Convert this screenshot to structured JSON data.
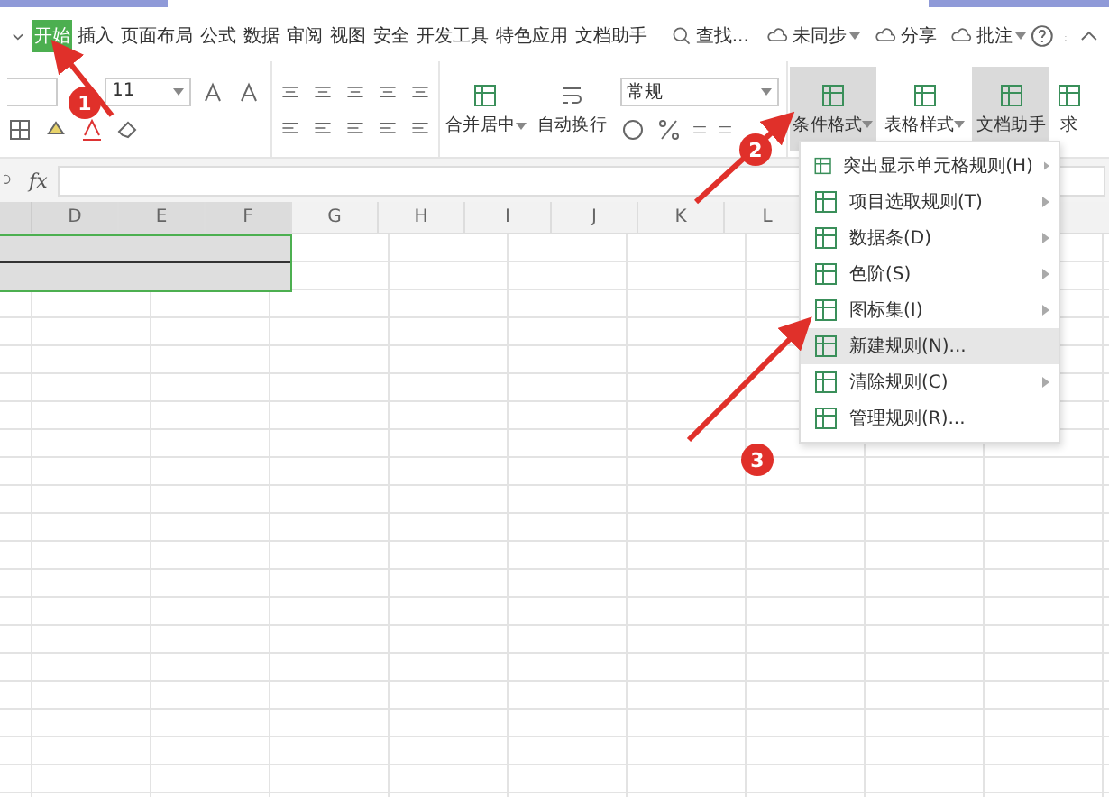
{
  "menu_bar": {
    "tabs": [
      {
        "label": "开始",
        "selected": true
      },
      {
        "label": "插入",
        "selected": false
      },
      {
        "label": "页面布局",
        "selected": false
      },
      {
        "label": "公式",
        "selected": false
      },
      {
        "label": "数据",
        "selected": false
      },
      {
        "label": "审阅",
        "selected": false
      },
      {
        "label": "视图",
        "selected": false
      },
      {
        "label": "安全",
        "selected": false
      },
      {
        "label": "开发工具",
        "selected": false
      },
      {
        "label": "特色应用",
        "selected": false
      },
      {
        "label": "文档助手",
        "selected": false
      }
    ],
    "search": {
      "placeholder": "查找..."
    },
    "actions": [
      {
        "label": "未同步",
        "dropdown": true
      },
      {
        "label": "分享",
        "dropdown": false
      },
      {
        "label": "批注",
        "dropdown": true
      }
    ]
  },
  "ribbon": {
    "font_size": "11",
    "merge_button": "合并居中",
    "wrap_button": "自动换行",
    "number_format": "常规",
    "big_buttons": [
      {
        "label": "条件格式",
        "pressed": true,
        "dropdown": true
      },
      {
        "label": "表格样式",
        "pressed": false,
        "dropdown": true
      },
      {
        "label": "文档助手",
        "pressed": true,
        "dropdown": false
      },
      {
        "label": "求",
        "pressed": false,
        "dropdown": false
      }
    ]
  },
  "formula_bar": {
    "fx": "fx"
  },
  "columns": [
    {
      "label": "D",
      "selected": true
    },
    {
      "label": "E",
      "selected": true
    },
    {
      "label": "F",
      "selected": true
    },
    {
      "label": "G",
      "selected": false
    },
    {
      "label": "H",
      "selected": false
    },
    {
      "label": "I",
      "selected": false
    },
    {
      "label": "J",
      "selected": false
    },
    {
      "label": "K",
      "selected": false
    },
    {
      "label": "L",
      "selected": false
    }
  ],
  "dropdown_menu": {
    "items": [
      {
        "label": "突出显示单元格规则(H)",
        "submenu": true,
        "selected": false
      },
      {
        "label": "项目选取规则(T)",
        "submenu": true,
        "selected": false
      },
      {
        "label": "数据条(D)",
        "submenu": true,
        "selected": false
      },
      {
        "label": "色阶(S)",
        "submenu": true,
        "selected": false
      },
      {
        "label": "图标集(I)",
        "submenu": true,
        "selected": false
      },
      {
        "label": "新建规则(N)...",
        "submenu": false,
        "selected": true
      },
      {
        "label": "清除规则(C)",
        "submenu": true,
        "selected": false
      },
      {
        "label": "管理规则(R)...",
        "submenu": false,
        "selected": false
      }
    ]
  },
  "annotations": [
    {
      "number": "1"
    },
    {
      "number": "2"
    },
    {
      "number": "3"
    }
  ]
}
